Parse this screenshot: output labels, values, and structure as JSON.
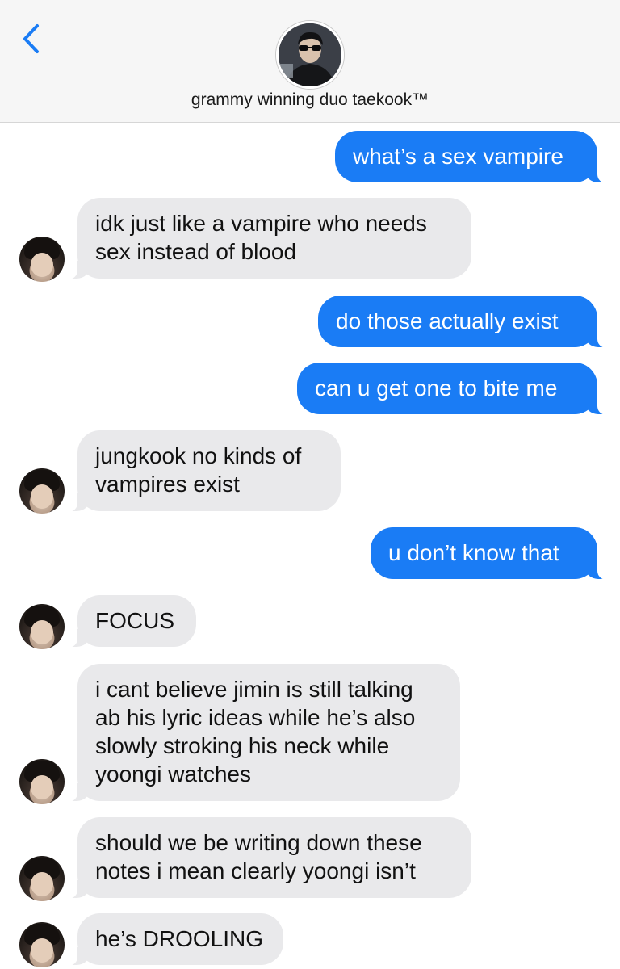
{
  "header": {
    "back_icon": "chevron-left-icon",
    "contact_name": "grammy winning duo taekook™",
    "accent_color": "#1a7cf5"
  },
  "messages": [
    {
      "direction": "sent",
      "text": "what’s a sex vampire"
    },
    {
      "direction": "received",
      "text": "idk just like a vampire who needs sex instead of blood"
    },
    {
      "direction": "sent",
      "text": "do those actually exist"
    },
    {
      "direction": "sent",
      "text": "can u get one to bite me"
    },
    {
      "direction": "received",
      "text": "jungkook no kinds of vampires exist"
    },
    {
      "direction": "sent",
      "text": "u don’t know that"
    },
    {
      "direction": "received",
      "text": "FOCUS"
    },
    {
      "direction": "received",
      "text": "i cant believe jimin is still talking ab his lyric ideas while he’s also slowly stroking his neck while yoongi watches"
    },
    {
      "direction": "received",
      "text": "should we be writing down these notes i mean clearly yoongi isn’t"
    },
    {
      "direction": "received",
      "text": "he’s DROOLING"
    }
  ],
  "colors": {
    "sent_bubble": "#1a7cf5",
    "received_bubble": "#e9e9eb",
    "header_bg": "#f6f6f6"
  }
}
